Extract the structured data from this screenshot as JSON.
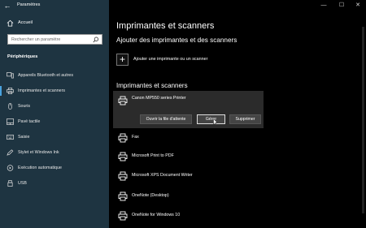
{
  "window": {
    "title": "Paramètres",
    "back_glyph": "←",
    "minimize_glyph": "—",
    "maximize_glyph": "☐",
    "close_glyph": "✕"
  },
  "sidebar": {
    "home_label": "Accueil",
    "search_placeholder": "Rechercher un paramètre",
    "section_label": "Périphériques",
    "items": [
      {
        "label": "Appareils Bluetooth et autres",
        "icon": "bluetooth-devices-icon",
        "active": false
      },
      {
        "label": "Imprimantes et scanners",
        "icon": "printer-icon",
        "active": true
      },
      {
        "label": "Souris",
        "icon": "mouse-icon",
        "active": false
      },
      {
        "label": "Pavé tactile",
        "icon": "touchpad-icon",
        "active": false
      },
      {
        "label": "Saisie",
        "icon": "keyboard-icon",
        "active": false
      },
      {
        "label": "Stylet et Windows Ink",
        "icon": "pen-icon",
        "active": false
      },
      {
        "label": "Exécution automatique",
        "icon": "autoplay-icon",
        "active": false
      },
      {
        "label": "USB",
        "icon": "usb-icon",
        "active": false
      }
    ]
  },
  "main": {
    "title": "Imprimantes et scanners",
    "add_section_title": "Ajouter des imprimantes et des scanners",
    "add_label": "Ajouter une imprimante ou un scanner",
    "list_title": "Imprimantes et scanners",
    "selected_printer": {
      "name": "Canon MP550 series Printer",
      "buttons": {
        "open_queue": "Ouvrir la file d'attente",
        "manage": "Gérer",
        "remove": "Supprimer"
      }
    },
    "printers": [
      {
        "name": "Fax",
        "icon": "fax-icon"
      },
      {
        "name": "Microsoft Print to PDF",
        "icon": "printer-icon"
      },
      {
        "name": "Microsoft XPS Document Writer",
        "icon": "printer-icon"
      },
      {
        "name": "OneNote (Desktop)",
        "icon": "printer-icon"
      },
      {
        "name": "OneNote for Windows 10",
        "icon": "printer-icon"
      }
    ]
  },
  "colors": {
    "sidebar_bg": "#1e3441",
    "accent": "#4aa3df",
    "main_bg": "#000000",
    "selected_bg": "#2b2b2b"
  }
}
